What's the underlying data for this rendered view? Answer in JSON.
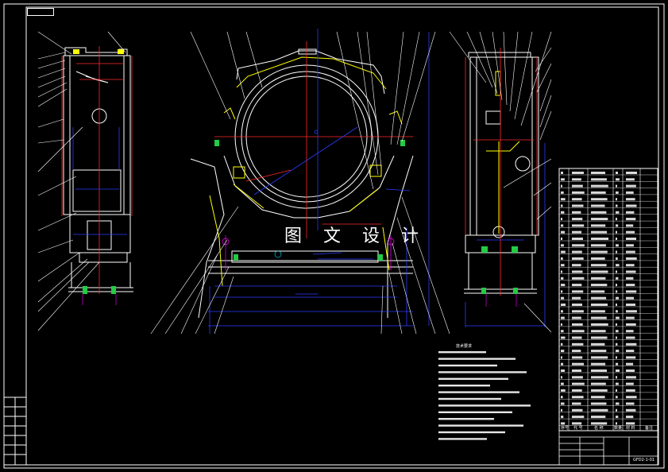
{
  "drawing": {
    "corner_tag": "",
    "watermark": "图 文 设 计",
    "drawing_number": "GFD2-1-01",
    "drawing_name": "",
    "tech_req_title": "技术要求",
    "header_row": [
      "序号",
      "代 号",
      "名 称",
      "数量",
      "材 料",
      "备注"
    ]
  },
  "colors": {
    "background": "#000000",
    "line_white": "#ffffff",
    "line_red": "#ff2a2a",
    "line_blue": "#2a3cff",
    "line_yellow": "#ffff00",
    "line_green": "#22cc44",
    "line_cyan": "#00e5ff",
    "line_magenta": "#ff00ff"
  }
}
